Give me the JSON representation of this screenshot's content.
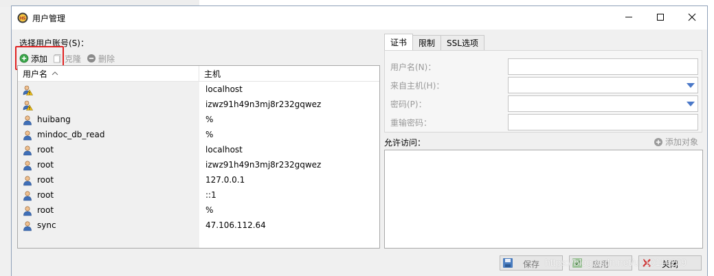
{
  "window": {
    "title": "用户管理"
  },
  "select_label": "选择用户账号(S)：",
  "toolbar": {
    "add": "添加",
    "clone": "克隆",
    "delete": "删除"
  },
  "columns": {
    "user": "用户名",
    "host": "主机"
  },
  "users": [
    {
      "name": "",
      "host": "localhost",
      "icon": "warning-user-icon"
    },
    {
      "name": "",
      "host": "izwz91h49n3mj8r232gqwez",
      "icon": "warning-user-icon"
    },
    {
      "name": "huibang",
      "host": "%",
      "icon": "user-icon"
    },
    {
      "name": "mindoc_db_read",
      "host": "%",
      "icon": "user-icon"
    },
    {
      "name": "root",
      "host": "localhost",
      "icon": "user-icon"
    },
    {
      "name": "root",
      "host": "izwz91h49n3mj8r232gqwez",
      "icon": "user-icon"
    },
    {
      "name": "root",
      "host": "127.0.0.1",
      "icon": "user-icon"
    },
    {
      "name": "root",
      "host": "::1",
      "icon": "user-icon"
    },
    {
      "name": "root",
      "host": "%",
      "icon": "user-icon"
    },
    {
      "name": "sync",
      "host": "47.106.112.64",
      "icon": "user-icon"
    }
  ],
  "tabs": [
    "证书",
    "限制",
    "SSL选项"
  ],
  "fields": {
    "username": "用户名(N)：",
    "from_host": "来自主机(H)：",
    "password": "密码(P)：",
    "confirm": "重输密码："
  },
  "allow": {
    "label": "允许访问：",
    "add_object": "添加对象"
  },
  "buttons": {
    "save": "保存",
    "apply": "应用",
    "close": "关闭"
  },
  "watermark": "https://blog.csdn.net/u010116209",
  "colors": {
    "highlight": "#e02020",
    "add_green": "#2e9e3a",
    "accent_blue": "#4a78c8"
  }
}
